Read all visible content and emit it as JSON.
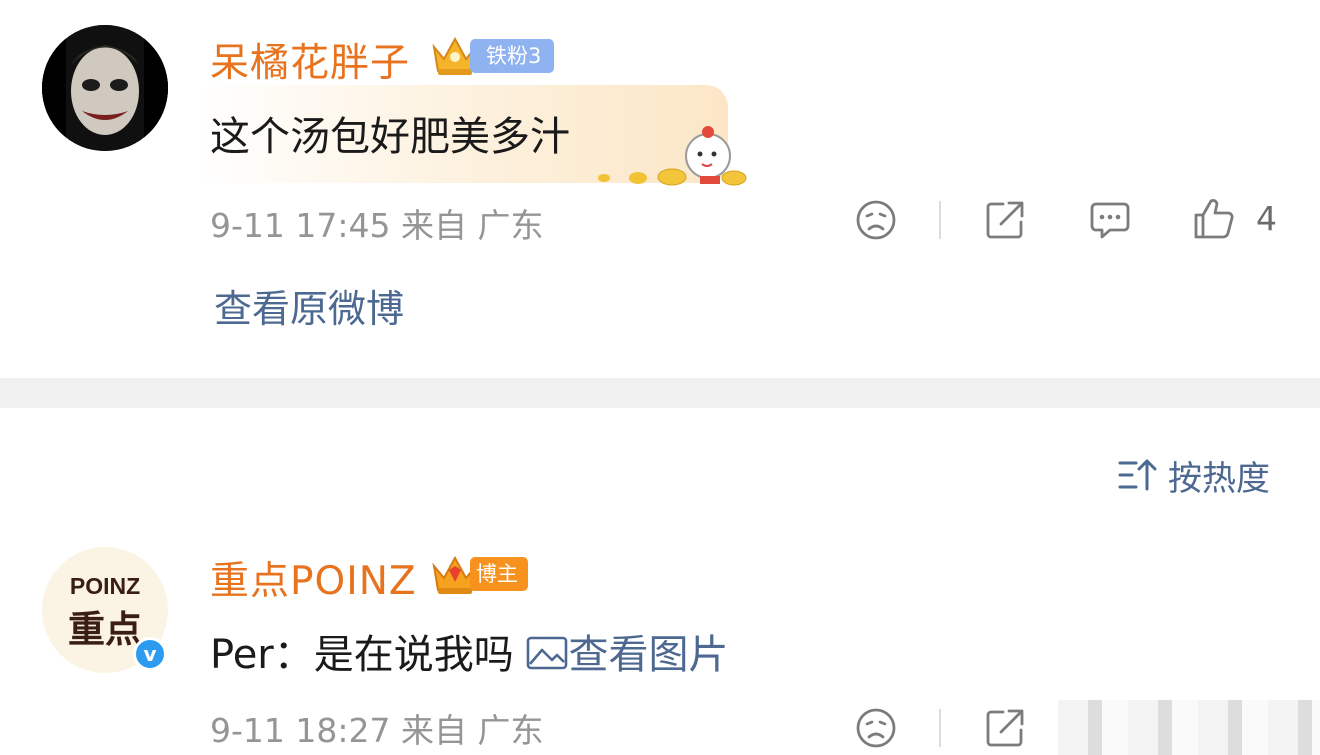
{
  "comments": [
    {
      "username": "呆橘花胖子",
      "badge": "铁粉3",
      "content": "这个汤包好肥美多汁",
      "meta": "9-11 17:45  来自 广东",
      "like_count": "4",
      "view_original": "查看原微博"
    },
    {
      "username": "重点POINZ",
      "badge": "博主",
      "avatar_text_top": "POINZ",
      "avatar_text_bottom": "重点",
      "verified": "v",
      "content_prefix": "Per：是在说我吗 ",
      "view_image": "查看图片",
      "meta": "9-11 18:27  来自 广东"
    }
  ],
  "sort": {
    "label": "按热度"
  },
  "colors": {
    "username": "#e8731f",
    "link": "#4d6891",
    "meta": "#959595",
    "separator": "#f0f0f0"
  },
  "icons": [
    "face-icon",
    "share-icon",
    "comment-icon",
    "like-icon",
    "sort-icon",
    "image-icon",
    "crown-icon"
  ]
}
